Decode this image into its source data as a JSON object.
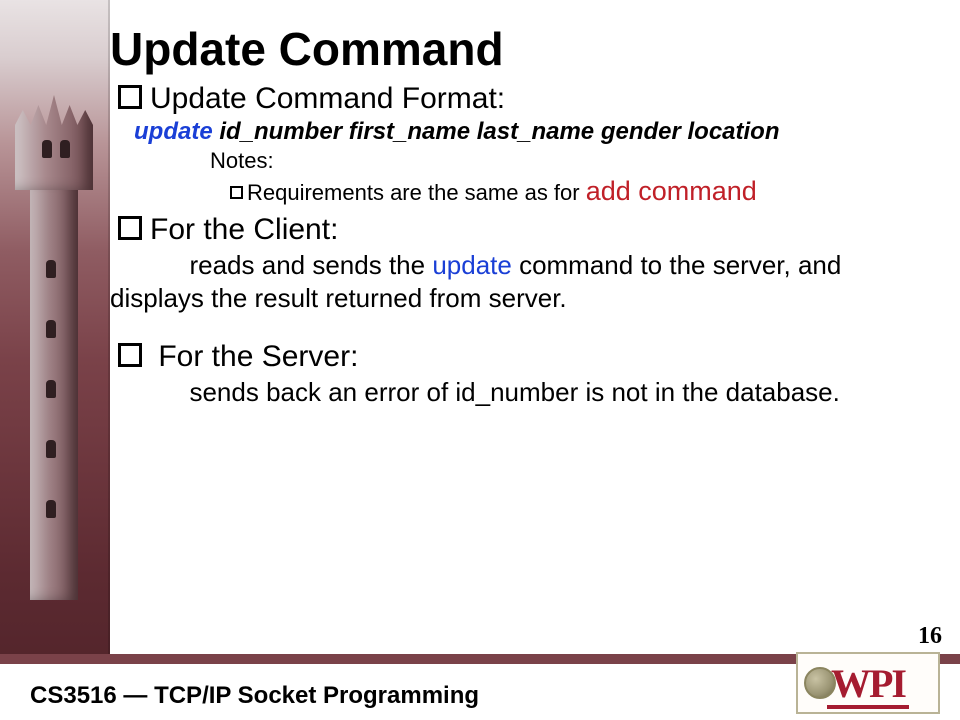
{
  "slide": {
    "title": "Update Command",
    "section_format": {
      "heading": "Update Command Format:",
      "command_keyword": "update",
      "command_args": "id_number first_name last_name gender location",
      "notes_label": "Notes:",
      "requirement_prefix": "Requirements are the same as for ",
      "requirement_highlight": "add command"
    },
    "section_client": {
      "heading": "For the Client:",
      "body_pre": "reads and sends the ",
      "body_keyword": "update",
      "body_post": " command to the server, and displays the result returned from server."
    },
    "section_server": {
      "heading": "For the Server:",
      "body": "sends back an error of id_number is not in the database."
    },
    "page_number": "16",
    "footer": "CS3516 — TCP/IP Socket Programming",
    "logo_text": "WPI"
  }
}
